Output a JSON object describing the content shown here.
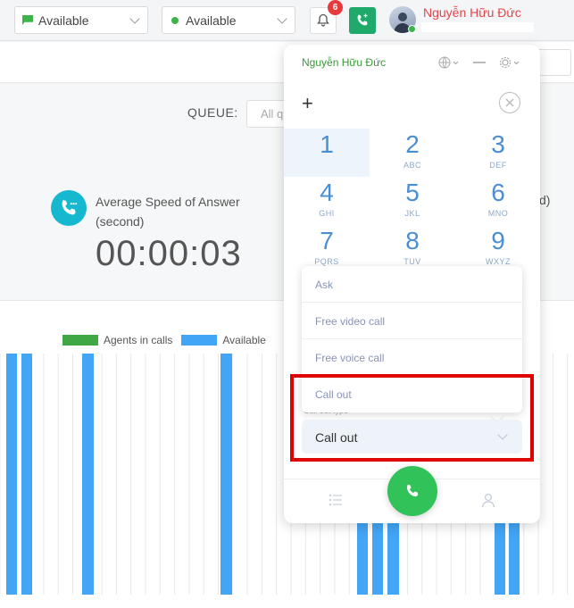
{
  "topbar": {
    "status_select_1": "Available",
    "status_select_2": "Available",
    "notification_count": "6",
    "user_name": "Nguyễn Hữu Đức",
    "brand_red": "#e0474c",
    "accent_green": "#1faa6b"
  },
  "dashboard": {
    "queue_label": "QUEUE:",
    "queue_placeholder": "All q",
    "asa_label": "Average Speed of Answer (second)",
    "asa_value": "00:00:03",
    "partial_text": "d)"
  },
  "chart_data": {
    "type": "bar",
    "series": [
      {
        "name": "Agents in calls",
        "color": "#3fa845"
      },
      {
        "name": "Available",
        "color": "#42a5f5"
      }
    ]
  },
  "popup": {
    "user_name": "Nguyễn Hữu Đức",
    "plus": "+",
    "keys": [
      {
        "num": "1",
        "letters": ""
      },
      {
        "num": "2",
        "letters": "ABC"
      },
      {
        "num": "3",
        "letters": "DEF"
      },
      {
        "num": "4",
        "letters": "GHI"
      },
      {
        "num": "5",
        "letters": "JKL"
      },
      {
        "num": "6",
        "letters": "MNO"
      },
      {
        "num": "7",
        "letters": "PQRS"
      },
      {
        "num": "8",
        "letters": "TUV"
      },
      {
        "num": "9",
        "letters": "WXYZ"
      }
    ],
    "menu_items": [
      "Ask",
      "Free video call",
      "Free voice call",
      "Call out"
    ],
    "call_type_label": "Call out type",
    "call_type_value": "Call out"
  }
}
